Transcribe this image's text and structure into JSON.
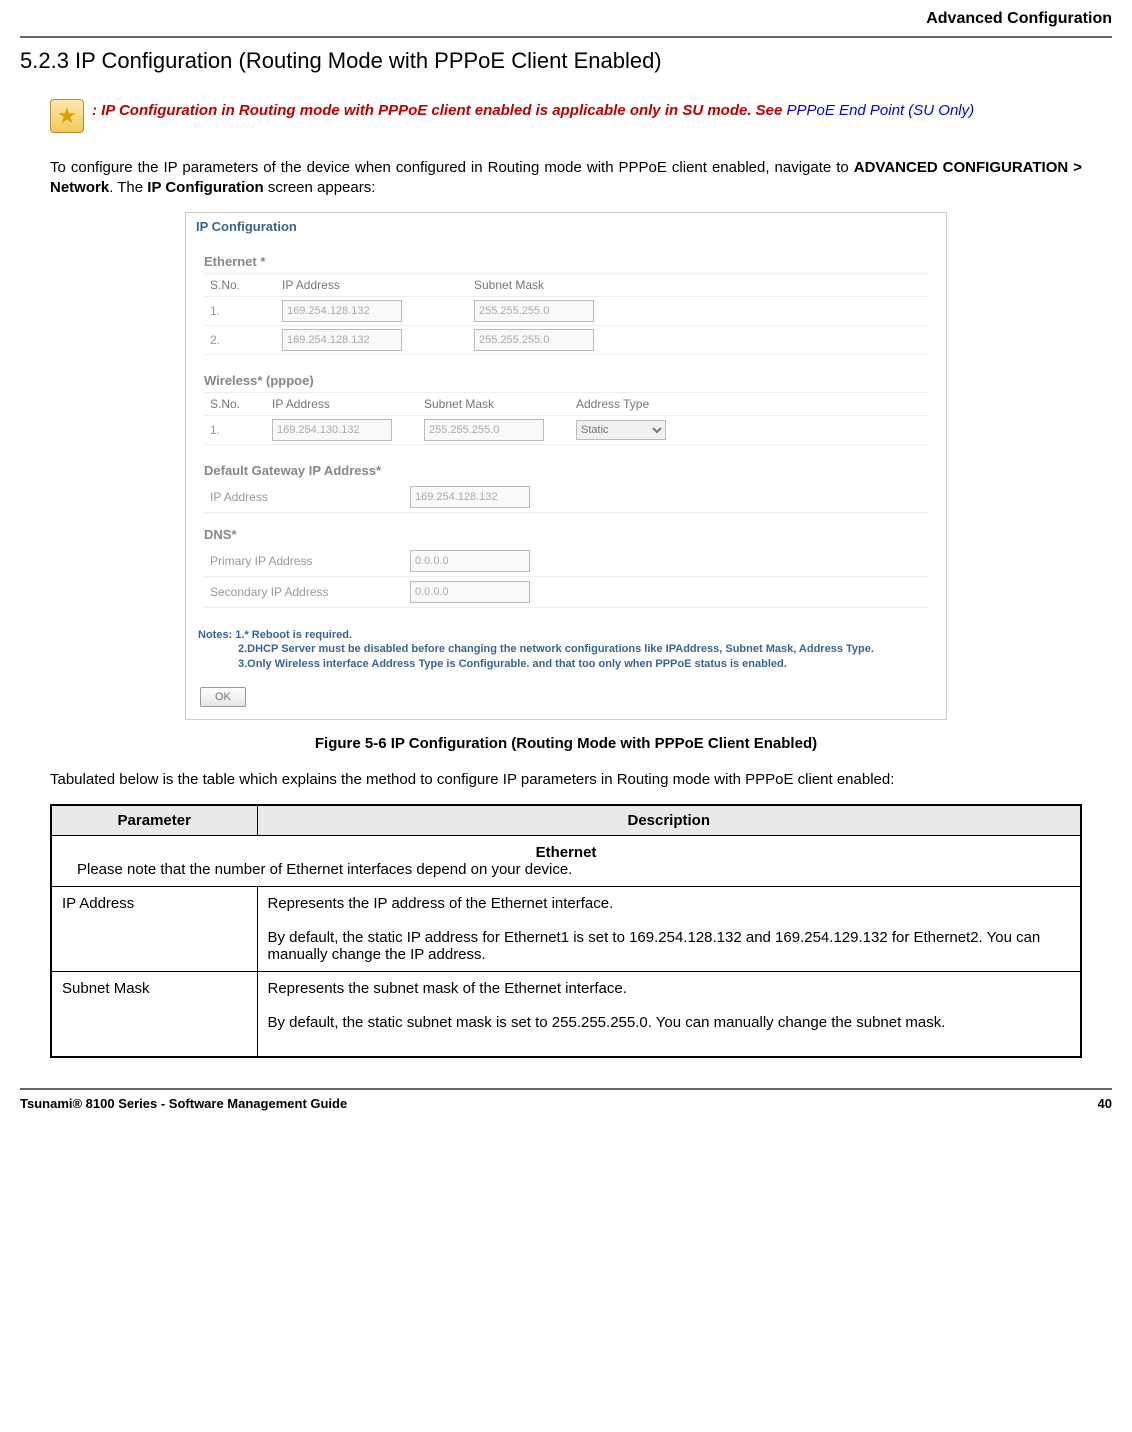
{
  "header": {
    "right": "Advanced Configuration"
  },
  "section_title": "5.2.3 IP Configuration (Routing Mode with PPPoE Client Enabled)",
  "note": {
    "red": ": IP Configuration in Routing mode with PPPoE client enabled is applicable only in SU mode. See ",
    "blue": "PPPoE End Point (SU Only)"
  },
  "body1_a": "To configure the IP parameters of the device when configured in Routing mode with PPPoE client enabled, navigate to ",
  "body1_b": "ADVANCED CONFIGURATION > Network",
  "body1_c": ". The ",
  "body1_d": "IP Configuration",
  "body1_e": " screen appears:",
  "screenshot": {
    "title": "IP Configuration",
    "eth_header": "Ethernet *",
    "eth_cols": {
      "sno": "S.No.",
      "ip": "IP Address",
      "mask": "Subnet Mask"
    },
    "eth": [
      {
        "sno": "1.",
        "ip": "169.254.128.132",
        "mask": "255.255.255.0"
      },
      {
        "sno": "2.",
        "ip": "169.254.128.132",
        "mask": "255.255.255.0"
      }
    ],
    "wl_header": "Wireless* (pppoe)",
    "wl_cols": {
      "sno": "S.No.",
      "ip": "IP Address",
      "mask": "Subnet Mask",
      "type": "Address Type"
    },
    "wl": [
      {
        "sno": "1.",
        "ip": "169.254.130.132",
        "mask": "255.255.255.0",
        "type": "Static"
      }
    ],
    "gw_header": "Default Gateway IP Address*",
    "gw_label": "IP Address",
    "gw_value": "169.254.128.132",
    "dns_header": "DNS*",
    "dns_primary_label": "Primary IP Address",
    "dns_primary_value": "0.0.0.0",
    "dns_secondary_label": "Secondary IP Address",
    "dns_secondary_value": "0.0.0.0",
    "notes_l1": "Notes: 1.* Reboot is required.",
    "notes_l2": "2.DHCP Server must be disabled before changing the network configurations like IPAddress, Subnet Mask, Address Type.",
    "notes_l3": "3.Only Wireless interface Address Type is Configurable. and that too only when PPPoE status is enabled.",
    "ok": "OK"
  },
  "figure_caption": "Figure 5-6 IP Configuration (Routing Mode with PPPoE Client Enabled)",
  "body2": "Tabulated below is the table which explains the method to configure IP parameters in Routing mode with PPPoE client enabled:",
  "table": {
    "h_param": "Parameter",
    "h_desc": "Description",
    "section_title": "Ethernet",
    "section_sub": "Please note that the number of Ethernet interfaces depend on your device.",
    "rows": [
      {
        "param": "IP Address",
        "desc_a": "Represents the IP address of the Ethernet interface.",
        "desc_b": "By default, the static IP address for Ethernet1 is set to 169.254.128.132 and 169.254.129.132 for Ethernet2. You can manually change the IP address."
      },
      {
        "param": "Subnet Mask",
        "desc_a": "Represents the subnet mask of the Ethernet interface.",
        "desc_b": "By default, the static subnet mask is set to 255.255.255.0. You can manually change the subnet mask."
      }
    ]
  },
  "footer": {
    "left": "Tsunami® 8100 Series - Software Management Guide",
    "right": "40"
  }
}
